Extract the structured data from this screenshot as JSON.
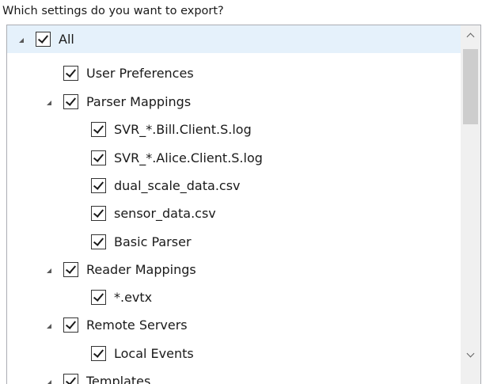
{
  "prompt": "Which settings do you want to export?",
  "tree": {
    "items": [
      {
        "label": "All",
        "checked": true,
        "expandable": true,
        "selected": true
      },
      {
        "label": "User Preferences",
        "checked": true,
        "expandable": false
      },
      {
        "label": "Parser Mappings",
        "checked": true,
        "expandable": true
      },
      {
        "label": "SVR_*.Bill.Client.S.log",
        "checked": true,
        "expandable": false
      },
      {
        "label": "SVR_*.Alice.Client.S.log",
        "checked": true,
        "expandable": false
      },
      {
        "label": "dual_scale_data.csv",
        "checked": true,
        "expandable": false
      },
      {
        "label": "sensor_data.csv",
        "checked": true,
        "expandable": false
      },
      {
        "label": "Basic Parser",
        "checked": true,
        "expandable": false
      },
      {
        "label": "Reader Mappings",
        "checked": true,
        "expandable": true
      },
      {
        "label": "*.evtx",
        "checked": true,
        "expandable": false
      },
      {
        "label": "Remote Servers",
        "checked": true,
        "expandable": true
      },
      {
        "label": "Local Events",
        "checked": true,
        "expandable": false
      },
      {
        "label": "Templates",
        "checked": true,
        "expandable": true
      }
    ]
  },
  "scrollbar": {
    "up_icon": "chevron-up-icon",
    "down_icon": "chevron-down-icon"
  },
  "colors": {
    "selected_row": "#e5f1fb",
    "border": "#abadb3",
    "scrollbar_track": "#f0f0f0",
    "scrollbar_thumb": "#cdcdcd"
  }
}
